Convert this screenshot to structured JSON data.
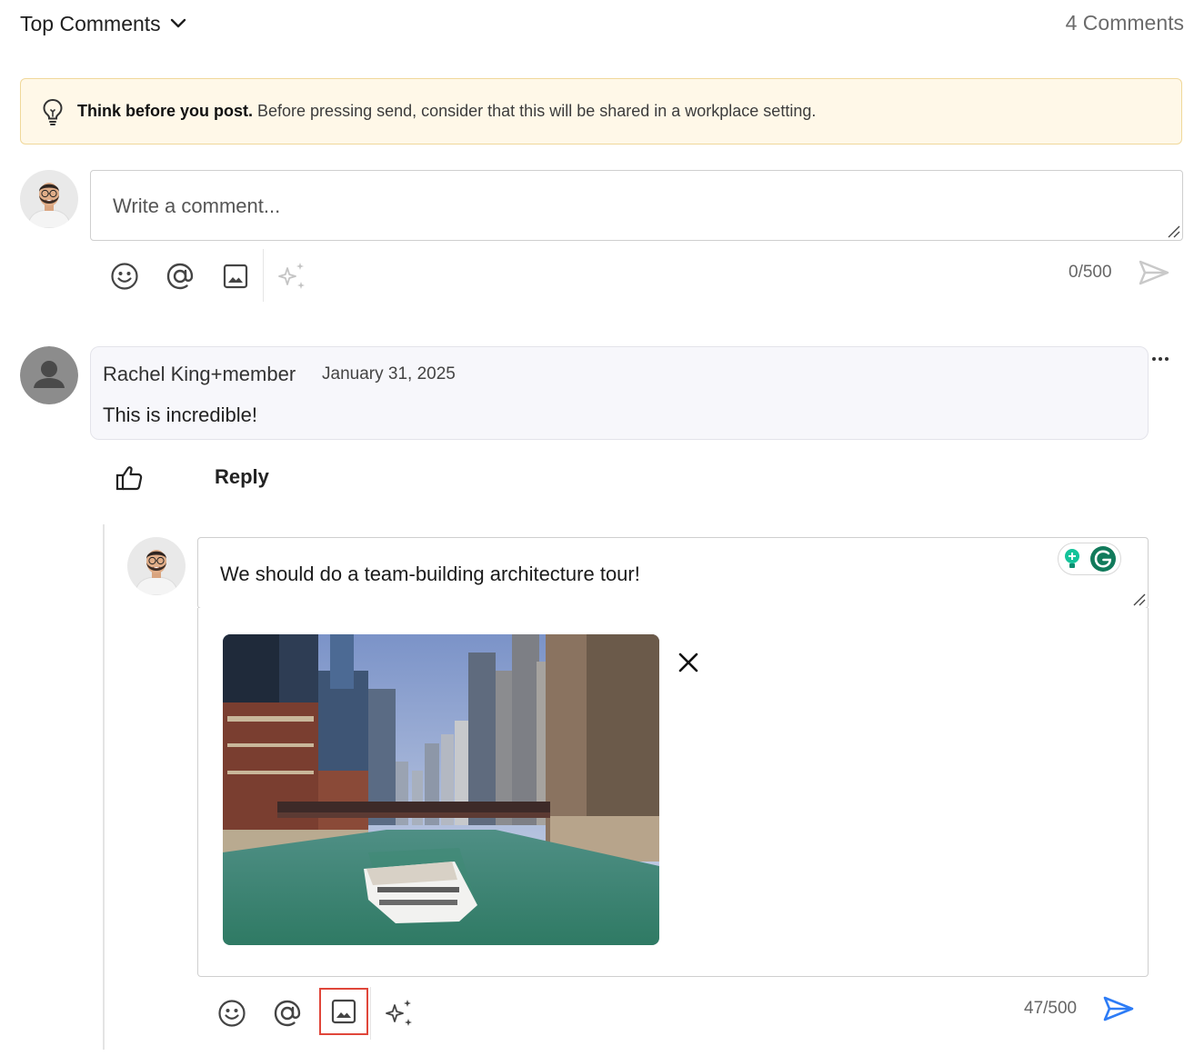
{
  "header": {
    "sort_label": "Top Comments",
    "comments_count": "4 Comments"
  },
  "banner": {
    "title": "Think before you post.",
    "text": " Before pressing send, consider that this will be shared in a workplace setting."
  },
  "composer": {
    "placeholder": "Write a comment...",
    "counter": "0/500"
  },
  "comment": {
    "author": "Rachel King+member",
    "date": "January 31, 2025",
    "text": "This is incredible!",
    "reply_label": "Reply"
  },
  "reply_composer": {
    "text": "We should do a team-building architecture tour!",
    "counter": "47/500",
    "attachment_icon": "photo-of-city-river-boat"
  },
  "colors": {
    "send_active": "#2d7cf6",
    "send_inactive": "#c9c9c9",
    "banner_bg": "#fff8e8",
    "highlight": "#e0463a"
  }
}
